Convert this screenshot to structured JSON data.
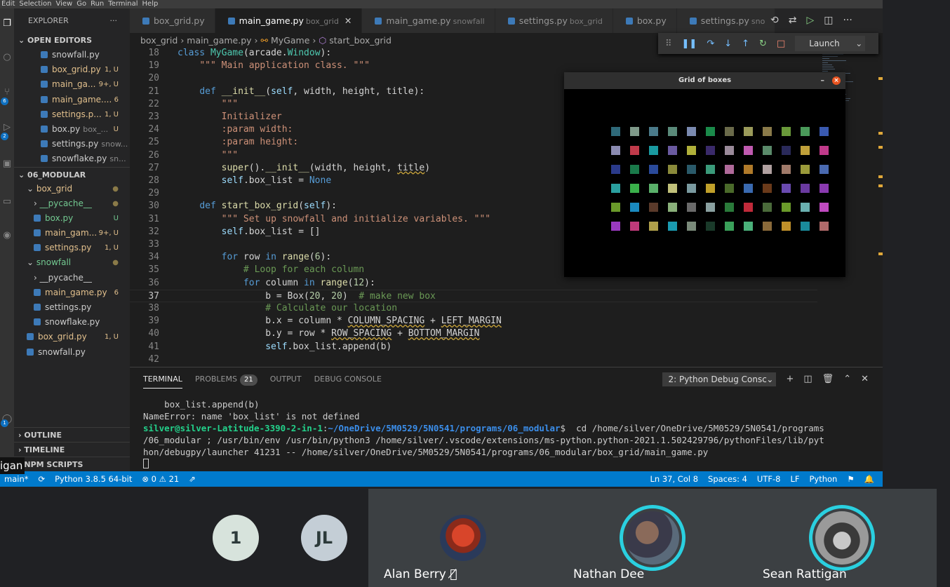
{
  "menubar": [
    "Edit",
    "Selection",
    "View",
    "Go",
    "Run",
    "Terminal",
    "Help"
  ],
  "activity_badges": [
    "6",
    "2",
    "1"
  ],
  "sidebar": {
    "title": "EXPLORER",
    "dots": "···",
    "open_editors_label": "OPEN EDITORS",
    "open_editors": [
      {
        "name": "snowfall.py",
        "status": "",
        "cls": ""
      },
      {
        "name": "box_grid.py",
        "status": "1, U",
        "cls": "mod"
      },
      {
        "name": "main_ga...",
        "status": "9+, U",
        "cls": "mod"
      },
      {
        "name": "main_game....",
        "status": "6",
        "cls": "mod"
      },
      {
        "name": "settings.p...",
        "status": "1, U",
        "cls": "mod"
      },
      {
        "name": "box.py",
        "sub": "box_...",
        "status": "U",
        "cls": "untr-name"
      },
      {
        "name": "settings.py",
        "sub": "snow...",
        "status": "",
        "cls": ""
      },
      {
        "name": "snowflake.py",
        "sub": "sn...",
        "status": "",
        "cls": ""
      }
    ],
    "folder_label": "06_MODULAR",
    "tree": [
      {
        "name": "box_grid",
        "status": "●",
        "indent": 18,
        "folder": true,
        "open": true,
        "cls": "mod"
      },
      {
        "name": "__pycache__",
        "status": "●",
        "indent": 28,
        "folder": true,
        "open": false,
        "cls": "untr"
      },
      {
        "name": "box.py",
        "status": "U",
        "indent": 28,
        "cls": "untr"
      },
      {
        "name": "main_gam...",
        "status": "9+, U",
        "indent": 28,
        "cls": "mod"
      },
      {
        "name": "settings.py",
        "status": "1, U",
        "indent": 28,
        "cls": "mod"
      },
      {
        "name": "snowfall",
        "status": "●",
        "indent": 18,
        "folder": true,
        "open": true,
        "cls": "untr"
      },
      {
        "name": "__pycache__",
        "status": "",
        "indent": 28,
        "folder": true,
        "open": false,
        "cls": ""
      },
      {
        "name": "main_game.py",
        "status": "6",
        "indent": 28,
        "cls": "mod"
      },
      {
        "name": "settings.py",
        "status": "",
        "indent": 28,
        "cls": ""
      },
      {
        "name": "snowflake.py",
        "status": "",
        "indent": 28,
        "cls": ""
      },
      {
        "name": "box_grid.py",
        "status": "1, U",
        "indent": 18,
        "cls": "mod"
      },
      {
        "name": "snowfall.py",
        "status": "",
        "indent": 18,
        "cls": ""
      }
    ],
    "bottom_sections": [
      "OUTLINE",
      "TIMELINE",
      "NPM SCRIPTS"
    ]
  },
  "tabs": [
    {
      "name": "box_grid.py",
      "sub": "",
      "active": false
    },
    {
      "name": "main_game.py",
      "sub": "box_grid",
      "active": true
    },
    {
      "name": "main_game.py",
      "sub": "snowfall",
      "active": false
    },
    {
      "name": "settings.py",
      "sub": "box_grid",
      "active": false
    },
    {
      "name": "box.py",
      "sub": "",
      "active": false
    },
    {
      "name": "settings.py",
      "sub": "sno",
      "active": false
    }
  ],
  "breadcrumb": [
    "box_grid",
    "main_game.py",
    "MyGame",
    "start_box_grid"
  ],
  "debug": {
    "config": "Launch"
  },
  "code": [
    {
      "n": "18",
      "html": "<span class='kw'>class</span> <span class='cls'>MyGame</span><span class='pl'>(arcade.</span><span class='cls'>Window</span><span class='pl'>):</span>"
    },
    {
      "n": "19",
      "html": "    <span class='str'>\"\"\" Main application class. \"\"\"</span>"
    },
    {
      "n": "20",
      "html": ""
    },
    {
      "n": "21",
      "html": "    <span class='kw'>def</span> <span class='fn'>__init__</span><span class='pl'>(</span><span class='sl'>self</span><span class='pl'>, width, height, title):</span>"
    },
    {
      "n": "22",
      "html": "        <span class='str'>\"\"\"</span>"
    },
    {
      "n": "23",
      "html": "        <span class='str'>Initializer</span>"
    },
    {
      "n": "24",
      "html": "        <span class='str'>:param width:</span>"
    },
    {
      "n": "25",
      "html": "        <span class='str'>:param height:</span>"
    },
    {
      "n": "26",
      "html": "        <span class='str'>\"\"\"</span>"
    },
    {
      "n": "27",
      "html": "        <span class='fn'>super</span><span class='pl'>().</span><span class='fn'>__init__</span><span class='pl'>(width, height, <span class='uw'>title</span>)</span>"
    },
    {
      "n": "28",
      "html": "        <span class='sl'>self</span><span class='pl'>.box_list = </span><span class='kw'>None</span>"
    },
    {
      "n": "29",
      "html": ""
    },
    {
      "n": "30",
      "html": "    <span class='kw'>def</span> <span class='fn'>start_box_grid</span><span class='pl'>(</span><span class='sl'>self</span><span class='pl'>):</span>"
    },
    {
      "n": "31",
      "html": "        <span class='str'>\"\"\" Set up snowfall and initialize variables. \"\"\"</span>"
    },
    {
      "n": "32",
      "html": "        <span class='sl'>self</span><span class='pl'>.box_list = []</span>"
    },
    {
      "n": "33",
      "html": ""
    },
    {
      "n": "34",
      "html": "        <span class='kw'>for</span> <span class='pl'>row</span> <span class='kw'>in</span> <span class='fn'>range</span><span class='pl'>(</span><span class='num'>6</span><span class='pl'>):</span>"
    },
    {
      "n": "35",
      "html": "            <span class='cm'># Loop for each column</span>"
    },
    {
      "n": "36",
      "html": "            <span class='kw'>for</span> <span class='pl'>column</span> <span class='kw'>in</span> <span class='fn'>range</span><span class='pl'>(</span><span class='num'>12</span><span class='pl'>):</span>"
    },
    {
      "n": "37",
      "html": "                <span class='pl'>b = Box(</span><span class='num'>20</span><span class='pl'>, </span><span class='num'>20</span><span class='pl'>)  </span><span class='cm'># make new box</span>",
      "cur": true
    },
    {
      "n": "38",
      "html": "                <span class='cm'># Calculate our location</span>"
    },
    {
      "n": "39",
      "html": "                <span class='pl'>b.x = column * <span class='uw'>COLUMN_SPACING</span> + <span class='uw'>LEFT_MARGIN</span></span>"
    },
    {
      "n": "40",
      "html": "                <span class='pl'>b.y = row * <span class='uw'>ROW_SPACING</span> + <span class='uw'>BOTTOM_MARGIN</span></span>"
    },
    {
      "n": "41",
      "html": "                <span class='sl'>self</span><span class='pl'>.box_list.append(b)</span>"
    },
    {
      "n": "42",
      "html": ""
    }
  ],
  "grid_window": {
    "title": "Grid of boxes",
    "min": "–",
    "close": "×",
    "rows": [
      [
        "#2f6a7a",
        "#7f9a8a",
        "#4a7a8a",
        "#5a8a7a",
        "#7a8ab0",
        "#1a8a4a",
        "#6a6a4a",
        "#9a9a5a",
        "#8a7a4a",
        "#6a9a3a",
        "#4a9a5a",
        "#3a5ab0"
      ],
      [
        "#8a8ab0",
        "#c03a4a",
        "#1a9aa0",
        "#6a5aa0",
        "#b0b03a",
        "#3a2a6a",
        "#9a8a9a",
        "#c05ab0",
        "#5a8a6a",
        "#2a2a5a",
        "#c0a03a",
        "#c03a8a"
      ],
      [
        "#2a3a8a",
        "#1a7a4a",
        "#2a4a9a",
        "#8a8a3a",
        "#2a5a6a",
        "#3a9a7a",
        "#b06a9a",
        "#b07a2a",
        "#b0a0a0",
        "#a07a6a",
        "#9a9a3a",
        "#4a6ab0"
      ],
      [
        "#2aa0a0",
        "#3ab04a",
        "#5ab06a",
        "#c0c07a",
        "#7a9aa0",
        "#c0a02a",
        "#4a6a2a",
        "#3a6ab0",
        "#6a3a1a",
        "#6a4ab0",
        "#6a3aa0",
        "#8a3ab0"
      ],
      [
        "#6a9a2a",
        "#1a8ac0",
        "#5a3a2a",
        "#8ab07a",
        "#6a6a6a",
        "#8aa0a0",
        "#2a7a3a",
        "#c02a3a",
        "#4a6a3a",
        "#6a9a2a",
        "#6ab0b0",
        "#c04ac0"
      ],
      [
        "#9a3ac0",
        "#c03a7a",
        "#b0a04a",
        "#1a9ab0",
        "#7a8a7a",
        "#1a3a2a",
        "#3aa05a",
        "#4ab07a",
        "#8a6a3a",
        "#c0902a",
        "#1a8a9a",
        "#b06a6a"
      ]
    ]
  },
  "panel": {
    "tabs": [
      "TERMINAL",
      "PROBLEMS",
      "OUTPUT",
      "DEBUG CONSOLE"
    ],
    "problems_count": "21",
    "console_select": "2: Python Debug Consc",
    "lines": [
      "    box_list.append(b)",
      "NameError: name 'box_list' is not defined"
    ],
    "prompt_user": "silver@silver-Latitude-3390-2-in-1",
    "prompt_path": "~/OneDrive/5M0529/5N0541/programs/06_modular",
    "cmd1": "  cd /home/silver/OneDrive/5M0529/5N0541/programs",
    "cmd2": "/06_modular ; /usr/bin/env /usr/bin/python3 /home/silver/.vscode/extensions/ms-python.python-2021.1.502429796/pythonFiles/lib/pyt",
    "cmd3": "hon/debugpy/launcher 41231 -- /home/silver/OneDrive/5M0529/5N0541/programs/06_modular/box_grid/main_game.py"
  },
  "status": {
    "branch": "main*",
    "python": "Python 3.8.5 64-bit",
    "errors": "0",
    "warnings": "21",
    "position": "Ln 37, Col 8",
    "spaces": "Spaces: 4",
    "encoding": "UTF-8",
    "eol": "LF",
    "language": "Python"
  },
  "presenter_tag": "igan",
  "participants": [
    {
      "kind": "initial",
      "label": "1",
      "bg": "#d7e3dc"
    },
    {
      "kind": "initial",
      "label": "JL",
      "bg": "#c4ced6"
    },
    {
      "kind": "photo",
      "name": "Alan Berry",
      "muted": true
    },
    {
      "kind": "photo",
      "name": "Nathan Dee",
      "speaking": true
    },
    {
      "kind": "photo",
      "name": "Sean Rattigan",
      "speaking": true
    }
  ]
}
